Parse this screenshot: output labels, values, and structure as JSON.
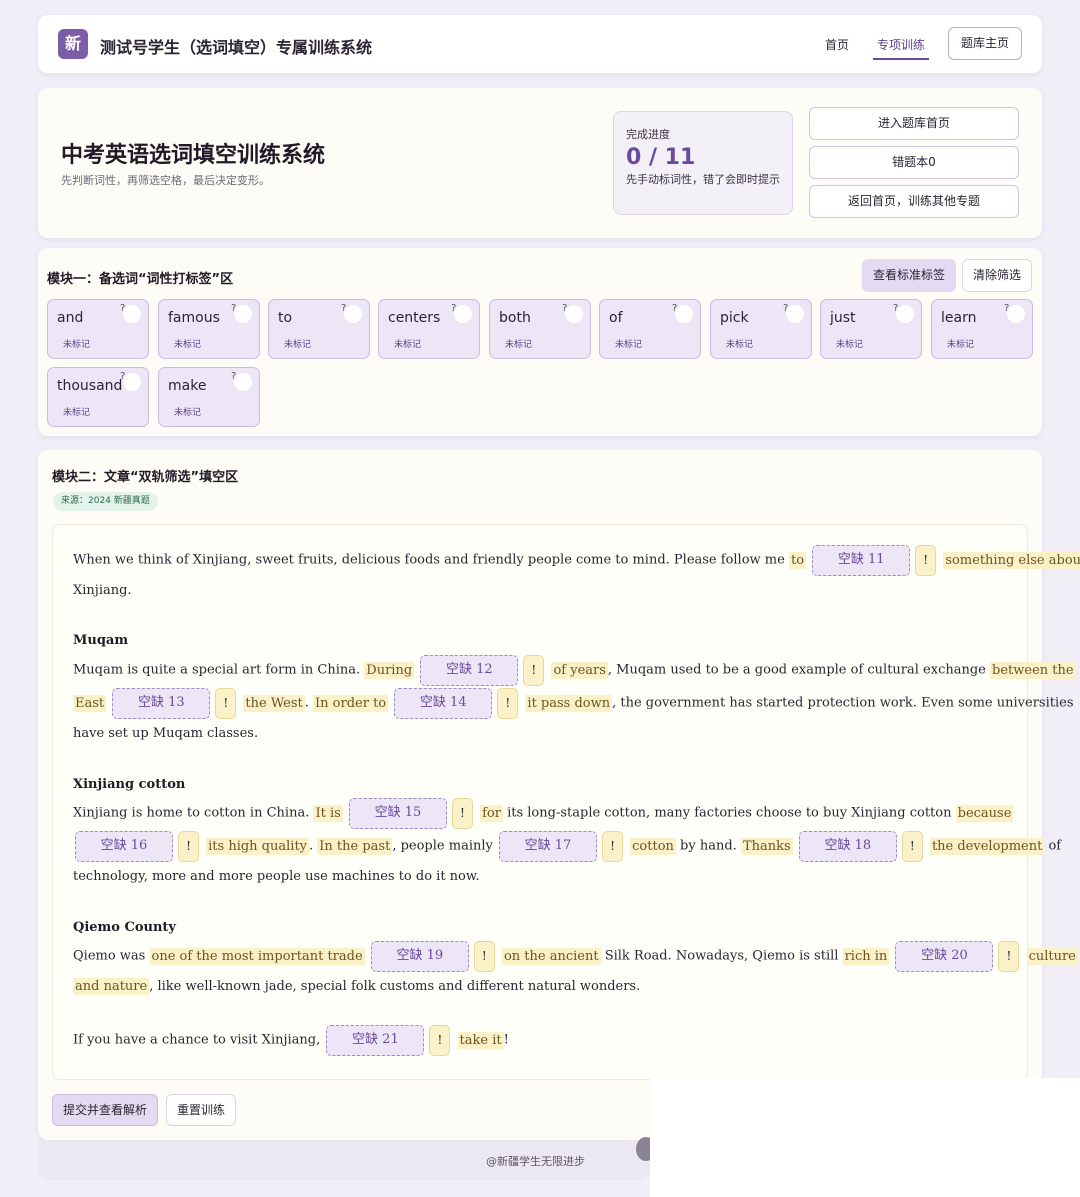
{
  "header": {
    "logo_char": "新",
    "title": "测试号学生（选词填空）专属训练系统",
    "nav": [
      "首页",
      "专项训练"
    ],
    "bank_button": "题库主页"
  },
  "hero": {
    "title": "中考英语选词填空训练系统",
    "subtitle": "先判断词性，再筛选空格，最后决定变形。",
    "progress_label": "完成进度",
    "progress_value": "0 / 11",
    "progress_hint": "先手动标词性，错了会即时提示",
    "buttons": [
      "进入题库首页",
      "错题本0",
      "返回首页，训练其他专题"
    ]
  },
  "module1": {
    "title": "模块一：备选词“词性打标签”区",
    "btn_standard": "查看标准标签",
    "btn_clear": "清除筛选",
    "status_label": "未标记",
    "help_mark": "?",
    "words": [
      "and",
      "famous",
      "to",
      "centers",
      "both",
      "of",
      "pick",
      "just",
      "learn",
      "thousand",
      "make"
    ]
  },
  "module2": {
    "title": "模块二：文章“双轨筛选”填空区",
    "source": "来源：2024 新疆真题",
    "bang": "!",
    "blanks": [
      "空缺 11",
      "空缺 12",
      "空缺 13",
      "空缺 14",
      "空缺 15",
      "空缺 16",
      "空缺 17",
      "空缺 18",
      "空缺 19",
      "空缺 20",
      "空缺 21"
    ],
    "p1": {
      "a": "When we think of Xinjiang, sweet fruits, delicious foods and friendly people come to mind. Please follow me",
      "h1": "to",
      "h2": "something else about",
      "b": "Xinjiang."
    },
    "h_muqam": "Muqam",
    "p2": {
      "a": "Muqam is quite a special art form in China.",
      "h1": "During",
      "h2": "of years",
      "b": ", Muqam used to be a good example of cultural exchange",
      "h3": "between the",
      "h4": "East",
      "h5": "the West",
      "c": ".",
      "h6": "In order to",
      "h7": "it pass down",
      "d": ", the government has started protection work. Even some universities",
      "e": "have set up Muqam classes."
    },
    "h_cotton": "Xinjiang cotton",
    "p3": {
      "a": "Xinjiang is home to cotton in China.",
      "h1": "It is",
      "h2": "for",
      "b": "its long-staple cotton, many factories choose to buy Xinjiang cotton",
      "h3": "because",
      "h4": "its high quality",
      "c": ".",
      "h5": "In the past",
      "d": ", people mainly",
      "h6": "cotton",
      "e": "by hand.",
      "h7": "Thanks",
      "h8": "the development",
      "f": "of",
      "g": "technology, more and more people use machines to do it now."
    },
    "h_qiemo": "Qiemo County",
    "p4": {
      "a": "Qiemo was",
      "h1": "one of the most important trade",
      "h2": "on the ancient",
      "b": "Silk Road. Nowadays, Qiemo is still",
      "h3": "rich in",
      "h4": "culture",
      "h5": "and nature",
      "c": ", like well-known jade, special folk customs and different natural wonders."
    },
    "p5": {
      "a": "If you have a chance to visit Xinjiang,",
      "h1": "take it",
      "b": "!"
    },
    "btn_submit": "提交并查看解析",
    "btn_reset": "重置训练"
  },
  "watermark": "@新疆学生无限进步"
}
